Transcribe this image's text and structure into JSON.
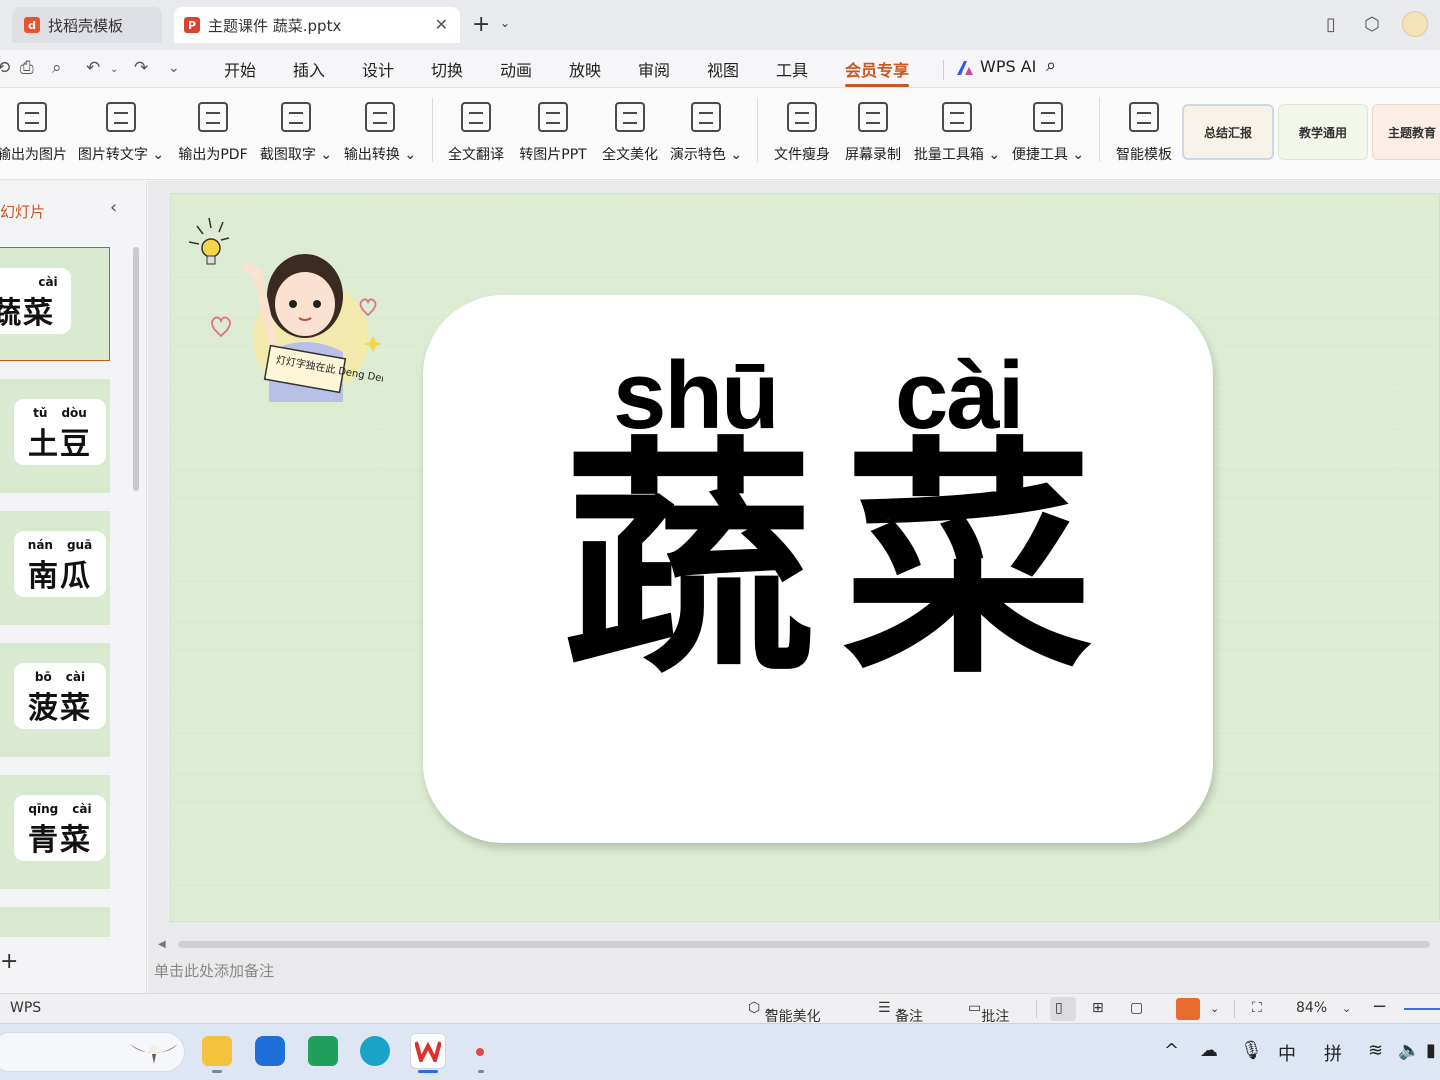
{
  "tabs": [
    {
      "label": "找稻壳模板",
      "icon": "docer-icon"
    },
    {
      "label": "主题课件 蔬菜.pptx",
      "icon": "ppt-icon"
    }
  ],
  "menu": [
    "开始",
    "插入",
    "设计",
    "切换",
    "动画",
    "放映",
    "审阅",
    "视图",
    "工具",
    "会员专享"
  ],
  "active_menu": "会员专享",
  "wps_ai": "WPS AI",
  "ribbon": [
    {
      "label": "输出为图片",
      "dropdown": false
    },
    {
      "label": "图片转文字",
      "dropdown": true
    },
    {
      "label": "输出为PDF",
      "dropdown": false
    },
    {
      "label": "截图取字",
      "dropdown": true
    },
    {
      "label": "输出转换",
      "dropdown": true
    },
    {
      "label": "全文翻译",
      "dropdown": false
    },
    {
      "label": "转图片PPT",
      "dropdown": false
    },
    {
      "label": "全文美化",
      "dropdown": false
    },
    {
      "label": "演示特色",
      "dropdown": true
    },
    {
      "label": "文件瘦身",
      "dropdown": false
    },
    {
      "label": "屏幕录制",
      "dropdown": false
    },
    {
      "label": "批量工具箱",
      "dropdown": true
    },
    {
      "label": "便捷工具",
      "dropdown": true
    },
    {
      "label": "智能模板",
      "dropdown": false
    }
  ],
  "templates": [
    "总结汇报",
    "教学通用",
    "主题教育"
  ],
  "panel": {
    "title": "幻灯片"
  },
  "thumbnails": [
    {
      "pinyin": [
        "",
        "cài"
      ],
      "hanzi": "蔬菜",
      "selected": true
    },
    {
      "pinyin": [
        "tǔ",
        "dòu"
      ],
      "hanzi": "土豆",
      "selected": false
    },
    {
      "pinyin": [
        "nán",
        "guā"
      ],
      "hanzi": "南瓜",
      "selected": false
    },
    {
      "pinyin": [
        "bō",
        "cài"
      ],
      "hanzi": "菠菜",
      "selected": false
    },
    {
      "pinyin": [
        "qīng",
        "cài"
      ],
      "hanzi": "青菜",
      "selected": false
    }
  ],
  "slide": {
    "pinyin": [
      "shū",
      "cài"
    ],
    "hanzi": [
      "蔬",
      "菜"
    ],
    "sticker": "灯灯字独在此 Deng Deng"
  },
  "notes_placeholder": "单击此处添加备注",
  "status": {
    "app": "WPS",
    "beautify": "智能美化",
    "notes": "备注",
    "comment": "批注",
    "zoom": "84%"
  },
  "tray": {
    "ime_lang": "中",
    "ime_mode": "拼"
  },
  "colors": {
    "accent": "#c8581f",
    "slide_bg": "#dcebd2",
    "ppt_orange": "#e76b2e"
  }
}
